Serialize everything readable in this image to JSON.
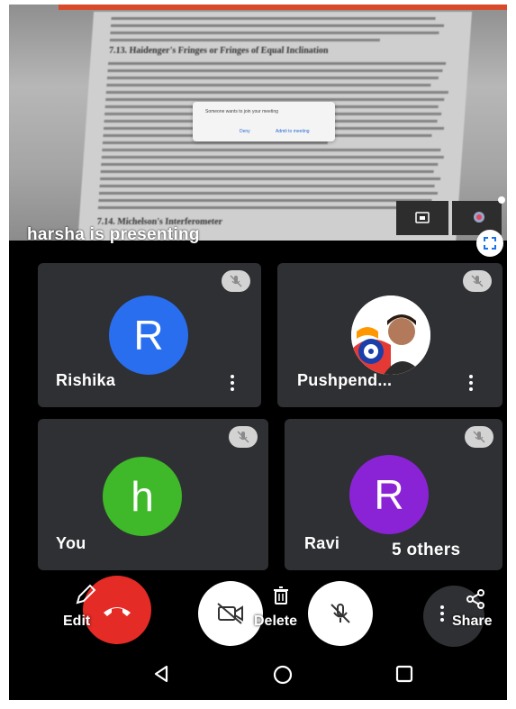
{
  "presenter": {
    "text": "harsha is presenting"
  },
  "shared_screen": {
    "headings": [
      "7.13. Haidenger's Fringes or Fringes of Equal Inclination",
      "7.14. Michelson's Interferometer"
    ],
    "dialog": {
      "message": "Someone wants to join your meeting",
      "deny_label": "Deny",
      "admit_label": "Admit to meeting"
    }
  },
  "participants": [
    {
      "name": "Rishika",
      "initial": "R",
      "color": "#2a6ef0"
    },
    {
      "name": "Pushpend...",
      "initial": "",
      "color": "#ffffff"
    },
    {
      "name": "You",
      "initial": "h",
      "color": "#3fb82a"
    },
    {
      "name": "Ravi",
      "initial": "R",
      "color": "#8a23d6"
    }
  ],
  "others": {
    "label": "5 others"
  },
  "controls": {
    "edit_label": "Edit",
    "delete_label": "Delete",
    "share_label": "Share"
  },
  "colors": {
    "end_call": "#e52b25",
    "tile_bg": "#2f3033",
    "background": "#000000"
  },
  "icons": [
    "mic-off-icon",
    "fullscreen-icon",
    "end-call-icon",
    "camera-off-icon",
    "pencil-icon",
    "trash-icon",
    "share-icon",
    "more-icon",
    "back-icon",
    "home-icon",
    "recents-icon"
  ]
}
